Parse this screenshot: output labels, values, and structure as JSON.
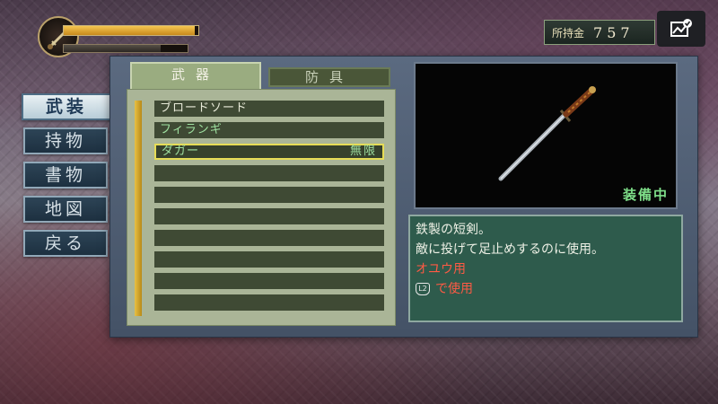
{
  "hud": {
    "health_fraction": 0.97,
    "special_fraction": 0.78
  },
  "money": {
    "label": "所持金",
    "value": "757"
  },
  "side_menu": {
    "items": [
      {
        "label": "武装",
        "active": true
      },
      {
        "label": "持物",
        "active": false
      },
      {
        "label": "書物",
        "active": false
      },
      {
        "label": "地図",
        "active": false
      },
      {
        "label": "戻る",
        "active": false
      }
    ]
  },
  "tabs": {
    "weapons": "武器",
    "armor": "防具"
  },
  "item_list": {
    "rows": [
      {
        "name": "ブロードソード",
        "qty": ""
      },
      {
        "name": "フィランギ",
        "qty": ""
      },
      {
        "name": "ダガー",
        "qty": "無限"
      }
    ]
  },
  "preview": {
    "status": "装備中"
  },
  "description": {
    "line1": "鉄製の短剣。",
    "line2": "敵に投げて足止めするのに使用。",
    "user": "オユウ用",
    "usage_button": "L2",
    "usage_text": "で使用"
  },
  "colors": {
    "health": "#f4c651",
    "equipped": "#7fe08a",
    "highlight": "#e6dc56",
    "warning": "#ff5a44"
  },
  "icons": {
    "share": "share-screenshot-icon",
    "emblem": "sword-emblem-icon",
    "weapon": "dagger-icon"
  }
}
